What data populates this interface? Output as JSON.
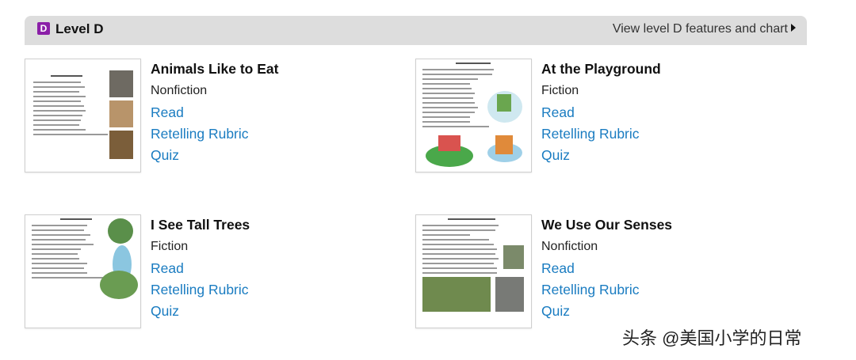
{
  "header": {
    "badge_letter": "D",
    "level_title": "Level D",
    "view_link": "View level D features and chart"
  },
  "books": [
    {
      "title": "Animals Like to Eat",
      "genre": "Nonfiction",
      "read": "Read",
      "rubric": "Retelling Rubric",
      "quiz": "Quiz"
    },
    {
      "title": "At the Playground",
      "genre": "Fiction",
      "read": "Read",
      "rubric": "Retelling Rubric",
      "quiz": "Quiz"
    },
    {
      "title": "I See Tall Trees",
      "genre": "Fiction",
      "read": "Read",
      "rubric": "Retelling Rubric",
      "quiz": "Quiz"
    },
    {
      "title": "We Use Our Senses",
      "genre": "Nonfiction",
      "read": "Read",
      "rubric": "Retelling Rubric",
      "quiz": "Quiz"
    }
  ],
  "watermark": "头条 @美国小学的日常",
  "colors": {
    "badge": "#8b1fa8",
    "link": "#1a7cc1",
    "header_bg": "#dddddd"
  }
}
